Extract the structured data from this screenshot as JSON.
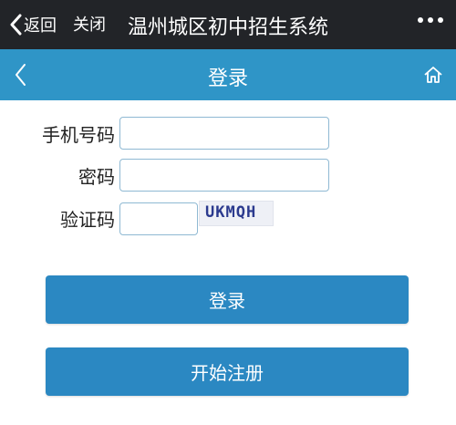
{
  "topbar": {
    "back_label": "返回",
    "close_label": "关闭",
    "title": "温州城区初中招生系统"
  },
  "navbar": {
    "title": "登录"
  },
  "form": {
    "phone_label": "手机号码",
    "password_label": "密码",
    "captcha_label": "验证码",
    "captcha_text": "UKMQH"
  },
  "buttons": {
    "login": "登录",
    "register": "开始注册"
  },
  "colors": {
    "topbar": "#222428",
    "navbar": "#2f95c7",
    "button": "#2b88c2"
  },
  "icons": {
    "back": "chevron-left-icon",
    "more": "more-dots-icon",
    "nav_back": "chevron-left-icon",
    "home": "home-icon"
  }
}
